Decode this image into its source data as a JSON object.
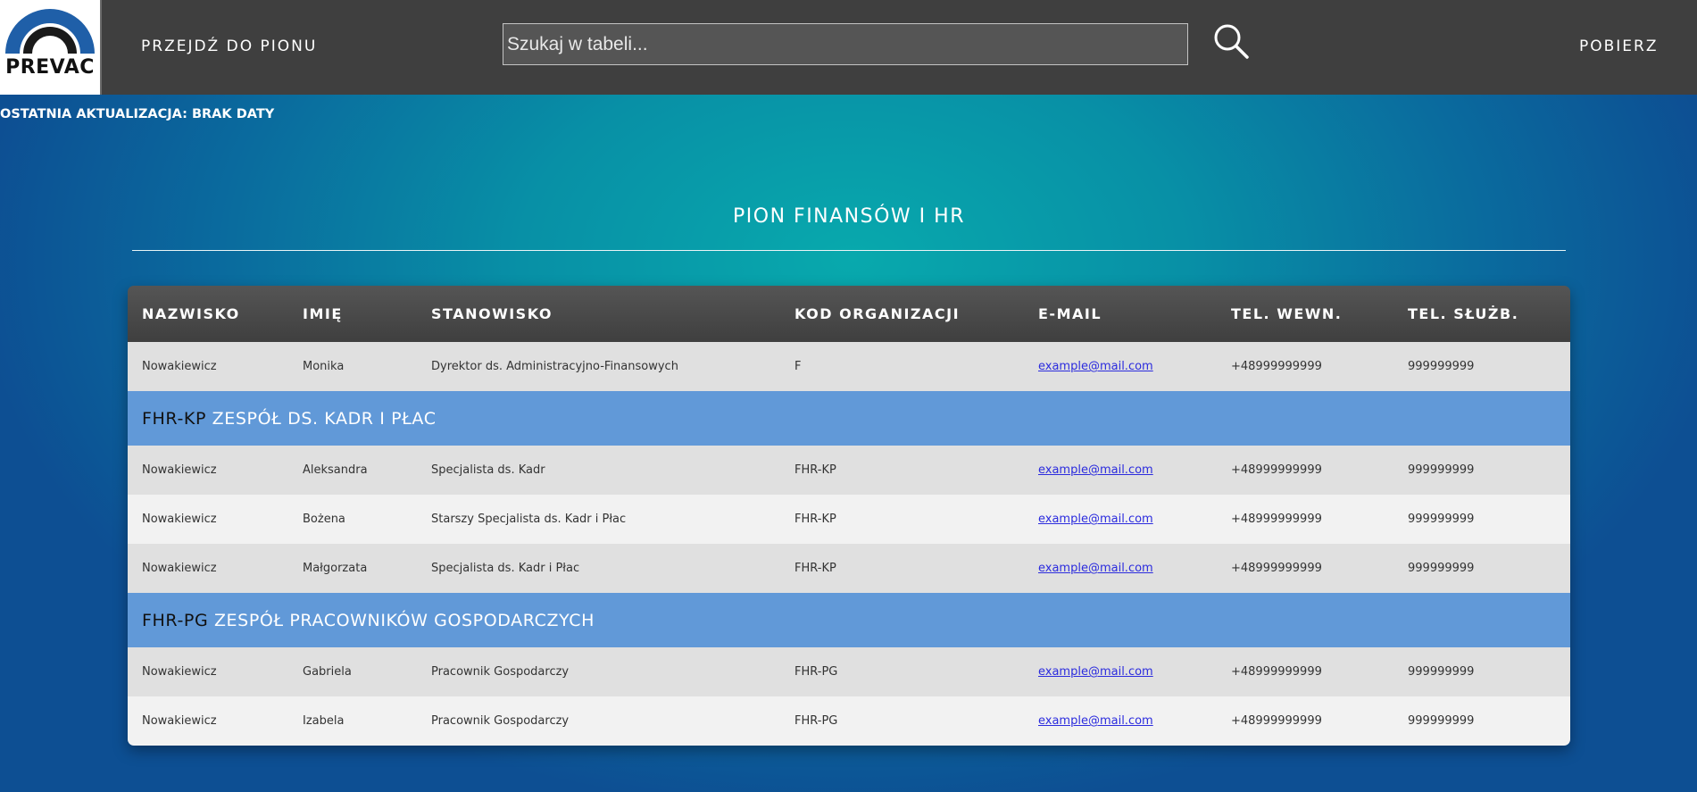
{
  "header": {
    "logo_text": "PREVAC",
    "nav_label": "PRZEJDŹ DO PIONU",
    "search_placeholder": "Szukaj w tabeli...",
    "search_value": "",
    "download_label": "POBIERZ"
  },
  "update_text": "OSTATNIA AKTUALIZACJA: BRAK DATY",
  "section_title": "PION FINANSÓW I HR",
  "table": {
    "columns": [
      "NAZWISKO",
      "IMIĘ",
      "STANOWISKO",
      "KOD ORGANIZACJI",
      "E-MAIL",
      "TEL. WEWN.",
      "TEL. SŁUŻB."
    ],
    "head_rows": [
      {
        "surname": "Nowakiewicz",
        "name": "Monika",
        "position": "Dyrektor ds. Administracyjno-Finansowych",
        "code": "F",
        "email": "example@mail.com",
        "tel_int": "+48999999999",
        "tel_off": "999999999"
      }
    ],
    "groups": [
      {
        "code": "FHR-KP",
        "title": "ZESPÓŁ DS. KADR I PŁAC",
        "rows": [
          {
            "surname": "Nowakiewicz",
            "name": "Aleksandra",
            "position": "Specjalista ds. Kadr",
            "code": "FHR-KP",
            "email": "example@mail.com",
            "tel_int": "+48999999999",
            "tel_off": "999999999"
          },
          {
            "surname": "Nowakiewicz",
            "name": "Bożena",
            "position": "Starszy Specjalista ds. Kadr i Płac",
            "code": "FHR-KP",
            "email": "example@mail.com",
            "tel_int": "+48999999999",
            "tel_off": "999999999"
          },
          {
            "surname": "Nowakiewicz",
            "name": "Małgorzata",
            "position": "Specjalista ds. Kadr i Płac",
            "code": "FHR-KP",
            "email": "example@mail.com",
            "tel_int": "+48999999999",
            "tel_off": "999999999"
          }
        ]
      },
      {
        "code": "FHR-PG",
        "title": "ZESPÓŁ PRACOWNIKÓW GOSPODARCZYCH",
        "rows": [
          {
            "surname": "Nowakiewicz",
            "name": "Gabriela",
            "position": "Pracownik Gospodarczy",
            "code": "FHR-PG",
            "email": "example@mail.com",
            "tel_int": "+48999999999",
            "tel_off": "999999999"
          },
          {
            "surname": "Nowakiewicz",
            "name": "Izabela",
            "position": "Pracownik Gospodarczy",
            "code": "FHR-PG",
            "email": "example@mail.com",
            "tel_int": "+48999999999",
            "tel_off": "999999999"
          }
        ]
      }
    ]
  },
  "colors": {
    "topbar": "#3f3f3f",
    "group_row": "#6199d8",
    "row_dark": "#e0e0e0",
    "row_light": "#f2f2f2",
    "link": "#2c2cde",
    "logo_arc": "#1f5fa8"
  },
  "icons": {
    "search": "search-icon",
    "logo": "prevac-logo"
  }
}
